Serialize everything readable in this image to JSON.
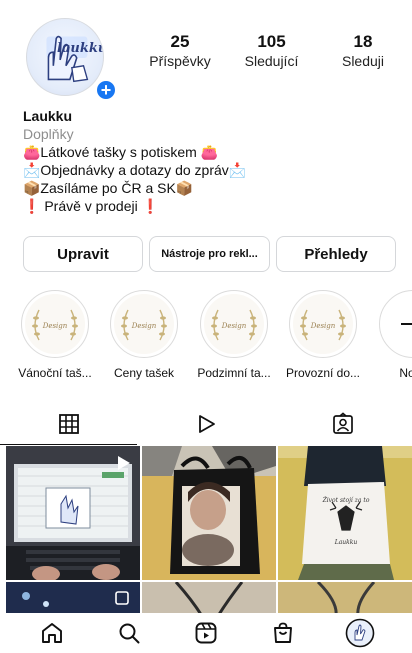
{
  "profile": {
    "username": "Laukku",
    "category": "Doplňky",
    "avatar_text": "laukku",
    "bio": [
      "👛Látkové tašky s potiskem 👛",
      "📩Objednávky a dotazy do zpráv📩",
      "📦Zasíláme po ČR a SK📦",
      "❗ Právě v prodeji ❗"
    ]
  },
  "stats": {
    "posts": {
      "count": "25",
      "label": "Příspěvky"
    },
    "followers": {
      "count": "105",
      "label": "Sledující"
    },
    "following": {
      "count": "18",
      "label": "Sleduji"
    }
  },
  "actions": {
    "edit_label": "Upravit",
    "tools_label": "Nástroje pro rekl...",
    "insights_label": "Přehledy"
  },
  "highlights": [
    {
      "label": "Vánoční taš...",
      "badge": "Design"
    },
    {
      "label": "Ceny tašek",
      "badge": "Design"
    },
    {
      "label": "Podzimní ta...",
      "badge": "Design"
    },
    {
      "label": "Provozní do...",
      "badge": "Design"
    },
    {
      "label": "Nový"
    }
  ],
  "tabs": [
    "grid-icon",
    "reels-icon",
    "tagged-icon"
  ],
  "posts": {
    "tote_caption": "Život stojí za to",
    "tote_subcaption": "Laukku"
  },
  "nav": [
    "home-icon",
    "search-icon",
    "reels-icon",
    "shop-icon",
    "profile-icon"
  ],
  "colors": {
    "accent": "#1877f2",
    "border": "#dbdbdb",
    "text": "#111111",
    "muted": "#8e8e8e"
  }
}
